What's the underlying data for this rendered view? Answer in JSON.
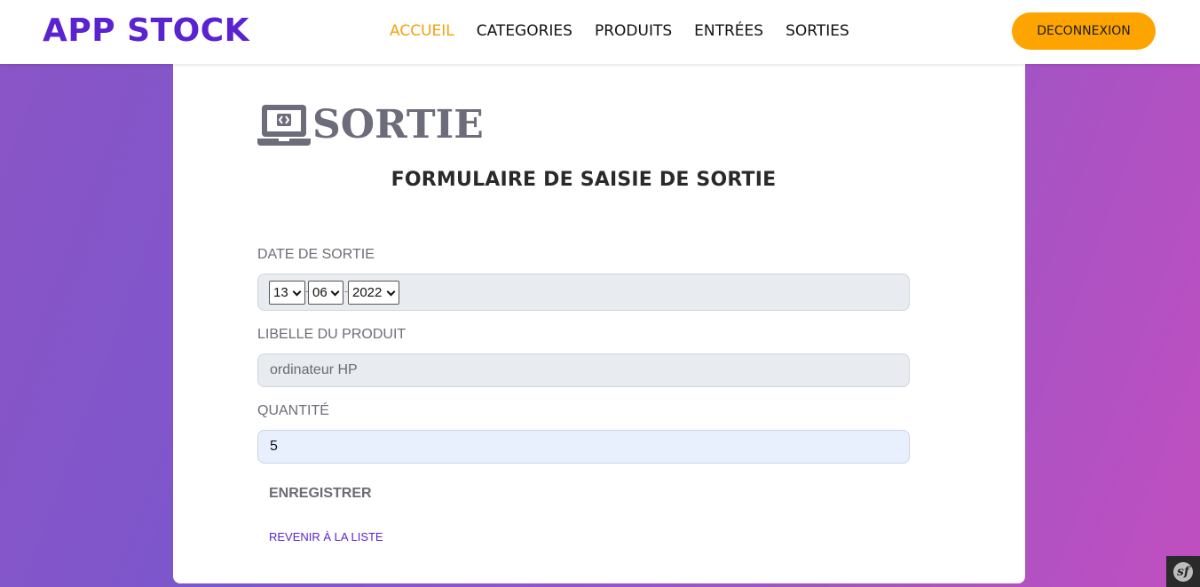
{
  "brand": "APP STOCK",
  "nav": {
    "items": [
      {
        "label": "ACCUEIL",
        "active": true
      },
      {
        "label": "CATEGORIES",
        "active": false
      },
      {
        "label": "PRODUITS",
        "active": false
      },
      {
        "label": "ENTRÉES",
        "active": false
      },
      {
        "label": "SORTIES",
        "active": false
      }
    ],
    "logout_label": "DECONNEXION"
  },
  "page": {
    "title": "SORTIE",
    "icon": "laptop-code-icon",
    "form_title": "FORMULAIRE DE SAISIE DE SORTIE"
  },
  "form": {
    "date": {
      "label": "DATE DE SORTIE",
      "day": "13",
      "month": "06",
      "year": "2022",
      "separator": "-"
    },
    "product": {
      "label": "LIBELLE DU PRODUIT",
      "value": "ordinateur HP"
    },
    "quantity": {
      "label": "QUANTITÉ",
      "value": "5"
    },
    "save_label": "ENREGISTRER",
    "back_label": "REVENIR À LA LISTE"
  },
  "debug_toolbar": {
    "icon": "symfony-icon",
    "glyph": "sf"
  },
  "colors": {
    "brand": "#5a23cf",
    "nav_active": "#f2a20b",
    "logout_bg": "#fea400",
    "gradient_start": "#8b55c6",
    "gradient_end": "#c04fc0"
  }
}
